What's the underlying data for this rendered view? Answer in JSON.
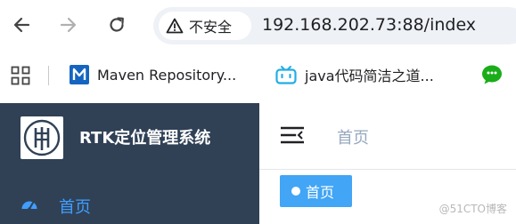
{
  "browser": {
    "security_label": "不安全",
    "url": "192.168.202.73:88/index",
    "bookmarks": [
      {
        "label": "Maven Repository...",
        "icon": "maven-icon"
      },
      {
        "label": "java代码简洁之道...",
        "icon": "bilibili-icon"
      }
    ]
  },
  "app": {
    "title": "RTK定位管理系统",
    "sidebar_menu": [
      {
        "label": "首页",
        "icon": "dashboard-icon"
      }
    ],
    "breadcrumb": "首页",
    "active_tag": "首页"
  },
  "watermark": "@51CTO博客",
  "colors": {
    "sidebar_bg": "#304156",
    "accent": "#409eff",
    "tag_bg": "#42a5f5"
  }
}
